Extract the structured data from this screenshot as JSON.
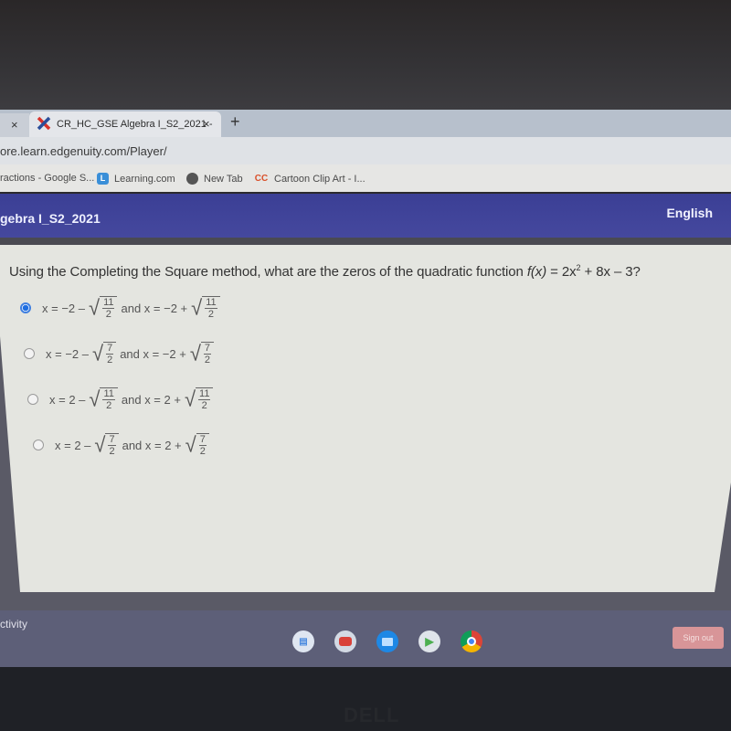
{
  "browser": {
    "tabs": [
      {
        "title": "",
        "close_label": "×"
      },
      {
        "title": "CR_HC_GSE Algebra I_S2_2021 -",
        "close_label": "×",
        "active": true,
        "icon": "edgenuity-x-icon"
      }
    ],
    "new_tab_label": "+",
    "url": "ore.learn.edgenuity.com/Player/",
    "bookmarks": [
      {
        "label": "ractions - Google S...",
        "icon": ""
      },
      {
        "label": "Learning.com",
        "icon": "L"
      },
      {
        "label": "New Tab",
        "icon": "globe-icon"
      },
      {
        "label": "Cartoon Clip Art - I...",
        "icon": "CC"
      }
    ]
  },
  "course_header": {
    "course_title": "gebra I_S2_2021",
    "language": "English"
  },
  "question": {
    "prefix": "Using the Completing the Square method, what are the zeros of the quadratic function ",
    "function_name": "f(x)",
    "equation_part1": " = 2x",
    "exponent": "2",
    "equation_part2": " + 8x – 3?",
    "options": [
      {
        "lead": "x = −2 –",
        "num": "11",
        "den": "2",
        "mid": "and x = −2 +",
        "num2": "11",
        "den2": "2",
        "selected": true
      },
      {
        "lead": "x = −2 –",
        "num": "7",
        "den": "2",
        "mid": "and x = −2 +",
        "num2": "7",
        "den2": "2",
        "selected": false
      },
      {
        "lead": "x = 2 –",
        "num": "11",
        "den": "2",
        "mid": "and x = 2 +",
        "num2": "11",
        "den2": "2",
        "selected": false
      },
      {
        "lead": "x = 2 –",
        "num": "7",
        "den": "2",
        "mid": "and x = 2 +",
        "num2": "7",
        "den2": "2",
        "selected": false
      }
    ]
  },
  "shelf": {
    "activity_label": "ctivity",
    "apps": [
      "docs-icon",
      "youtube-icon",
      "files-icon",
      "play-store-icon",
      "chrome-icon"
    ],
    "sign_out_label": "Sign out"
  },
  "device": {
    "brand": "DELL"
  },
  "colors": {
    "header_bg": "#3b3f95",
    "radio_selected": "#1f6ee0",
    "panel_bg": "#e4e5e0",
    "shelf_bg": "#5d5f78"
  }
}
